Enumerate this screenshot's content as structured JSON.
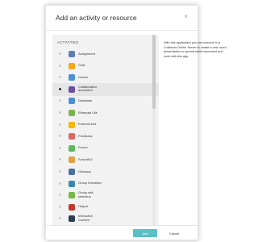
{
  "modal": {
    "title": "Add an activity or resource",
    "close_glyph": "×"
  },
  "activities": {
    "heading": "ACTIVITIES",
    "items": [
      {
        "label": "Assignment",
        "icon": "assignment-icon",
        "color": "#5b7fb8",
        "selected": false
      },
      {
        "label": "Chat",
        "icon": "chat-icon",
        "color": "#f4a623",
        "selected": false
      },
      {
        "label": "Choice",
        "icon": "choice-icon",
        "color": "#4a90d9",
        "selected": false
      },
      {
        "label": "Collaborative\ndocument",
        "icon": "collaborative-document-icon",
        "color": "#6b4fa0",
        "selected": true
      },
      {
        "label": "Database",
        "icon": "database-icon",
        "color": "#4a90d9",
        "selected": false
      },
      {
        "label": "Etherpad Lite",
        "icon": "etherpad-lite-icon",
        "color": "#7ab648",
        "selected": false
      },
      {
        "label": "External tool",
        "icon": "external-tool-icon",
        "color": "#f5b800",
        "selected": false
      },
      {
        "label": "Feedback",
        "icon": "feedback-icon",
        "color": "#e06666",
        "selected": false
      },
      {
        "label": "Forum",
        "icon": "forum-icon",
        "color": "#5cb85c",
        "selected": false
      },
      {
        "label": "ForumNG",
        "icon": "forumng-icon",
        "color": "#e0a040",
        "selected": false
      },
      {
        "label": "Glossary",
        "icon": "glossary-icon",
        "color": "#4a6fa5",
        "selected": false
      },
      {
        "label": "Group formation",
        "icon": "group-formation-icon",
        "color": "#3a87ad",
        "selected": false
      },
      {
        "label": "Group self-\nselection",
        "icon": "group-self-selection-icon",
        "color": "#7ab648",
        "selected": false
      },
      {
        "label": "Hotpot",
        "icon": "hotpot-icon",
        "color": "#c0392b",
        "selected": false
      },
      {
        "label": "Interactive\nContent",
        "icon": "interactive-content-icon",
        "color": "#2c3e50",
        "selected": false
      }
    ]
  },
  "description": "With this application you can connect to a Collabora Online Server to create a new, word, presentation or spread sheet document and work with this app.",
  "footer": {
    "add_label": "Add",
    "cancel_label": "Cancel"
  },
  "colors": {
    "accent": "#5ac0c5"
  }
}
